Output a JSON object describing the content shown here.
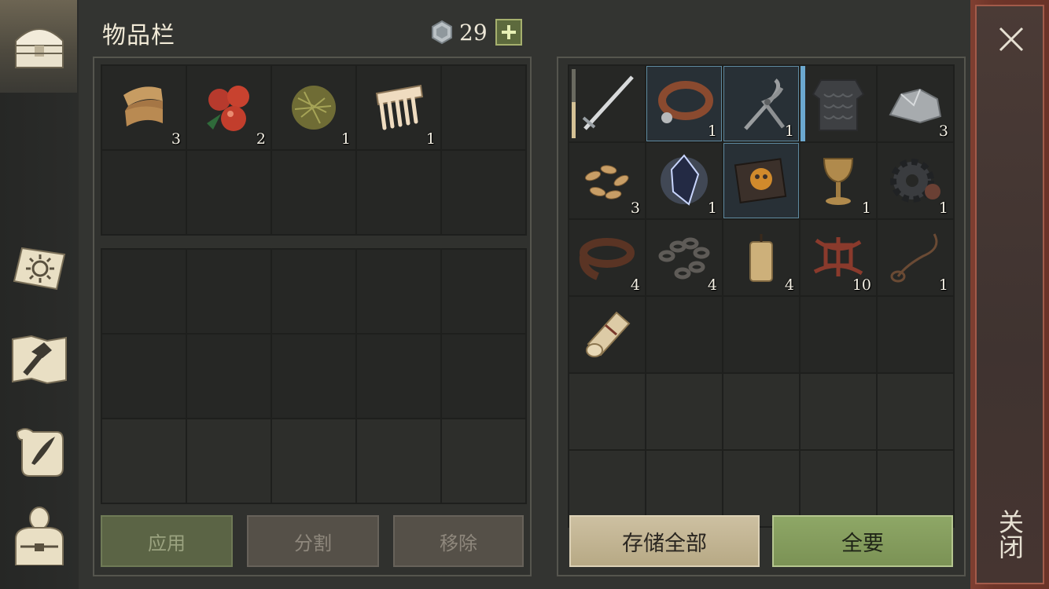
{
  "header": {
    "title": "物品栏",
    "currency_count": "29"
  },
  "inventory": {
    "items": [
      {
        "name": "cloth-scraps",
        "qty": "3"
      },
      {
        "name": "berries",
        "qty": "2"
      },
      {
        "name": "grass-ball",
        "qty": "1"
      },
      {
        "name": "comb",
        "qty": "1"
      }
    ]
  },
  "storage": {
    "items": [
      {
        "name": "sword",
        "qty": ""
      },
      {
        "name": "collar",
        "qty": "1"
      },
      {
        "name": "pliers",
        "qty": "1"
      },
      {
        "name": "scale-armor",
        "qty": ""
      },
      {
        "name": "silver-ore",
        "qty": "3"
      },
      {
        "name": "seeds",
        "qty": "3"
      },
      {
        "name": "crystal",
        "qty": "1"
      },
      {
        "name": "book",
        "qty": ""
      },
      {
        "name": "goblet",
        "qty": "1"
      },
      {
        "name": "gear",
        "qty": "1"
      },
      {
        "name": "leather-strip",
        "qty": "4"
      },
      {
        "name": "chain",
        "qty": "4"
      },
      {
        "name": "candle",
        "qty": "4"
      },
      {
        "name": "rope-knot",
        "qty": "10"
      },
      {
        "name": "noose-rope",
        "qty": "1"
      },
      {
        "name": "scroll",
        "qty": ""
      }
    ]
  },
  "buttons": {
    "apply": "应用",
    "split": "分割",
    "remove": "移除",
    "store_all": "存储全部",
    "take_all": "全要"
  },
  "close_label": "关闭",
  "colors": {
    "accent_green": "#8ea766",
    "close_red": "#7f3f31",
    "highlight_blue": "#6ca8cf"
  }
}
